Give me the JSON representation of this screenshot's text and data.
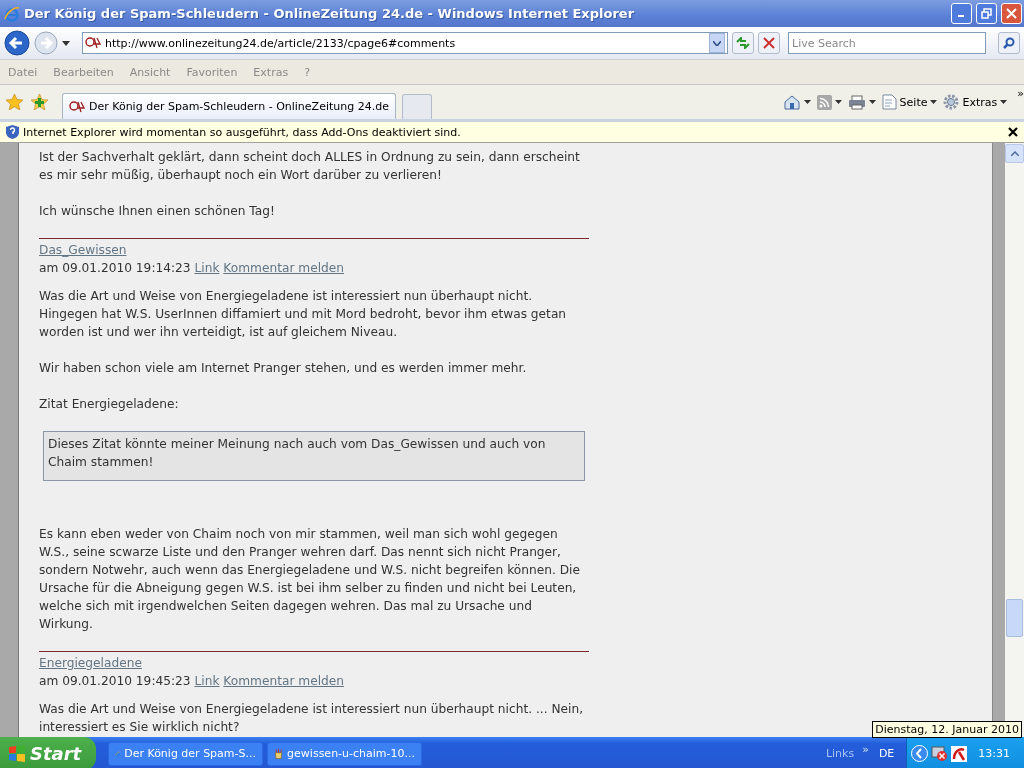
{
  "window": {
    "title": "Der König der Spam-Schleudern - OnlineZeitung 24.de - Windows Internet Explorer"
  },
  "address": {
    "value": "http://www.onlinezeitung24.de/article/2133/cpage6#comments"
  },
  "search": {
    "placeholder": "Live Search"
  },
  "menu": [
    "Datei",
    "Bearbeiten",
    "Ansicht",
    "Favoriten",
    "Extras",
    "?"
  ],
  "tabs": [
    {
      "label": "Der König der Spam-Schleudern - OnlineZeitung 24.de",
      "selected": true
    }
  ],
  "commands": [
    {
      "kind": "home"
    },
    {
      "kind": "feed"
    },
    {
      "kind": "print"
    },
    {
      "kind": "page",
      "label": "Seite"
    },
    {
      "kind": "tools",
      "label": "Extras"
    }
  ],
  "overflow": "»",
  "info_bar": {
    "text": "Internet Explorer wird momentan so ausgeführt, dass Add-Ons deaktiviert sind."
  },
  "intro": [
    "Ist der Sachverhalt geklärt, dann scheint doch ALLES in Ordnung zu sein, dann erscheint es mir sehr müßig, überhaupt noch ein Wort darüber zu verlieren!",
    "Ich wünsche Ihnen einen schönen Tag!"
  ],
  "comments": [
    {
      "author": "Das_Gewissen",
      "meta": "am 09.01.2010 19:14:23",
      "links": [
        "Link",
        "Kommentar melden"
      ],
      "blocks": [
        {
          "kind": "p",
          "text": "Was die Art und Weise von Energiegeladene ist interessiert nun überhaupt nicht. Hingegen hat W.S. UserInnen diffamiert und mit Mord bedroht, bevor ihm etwas getan worden ist und wer ihn verteidigt, ist auf gleichem Niveau."
        },
        {
          "kind": "p",
          "text": "Wir haben schon viele am Internet Pranger stehen, und es werden immer mehr."
        },
        {
          "kind": "p",
          "text": "Zitat Energiegeladene:"
        },
        {
          "kind": "quote",
          "text": "Dieses Zitat könnte meiner Meinung nach auch vom Das_Gewissen und auch von Chaim stammen!"
        },
        {
          "kind": "p",
          "text": "Es kann eben weder von Chaim noch von mir stammen, weil man sich wohl gegegen W.S., seine scwarze Liste und den Pranger wehren darf. Das nennt sich nicht Pranger, sondern Notwehr, auch wenn das Energiegeladene und W.S. nicht begreifen können. Die Ursache für die Abneigung gegen W.S. ist bei ihm selber zu finden und nicht bei Leuten, welche sich mit irgendwelchen Seiten dagegen wehren. Das mal zu Ursache und Wirkung."
        }
      ]
    },
    {
      "author": "Energiegeladene",
      "meta": "am 09.01.2010 19:45:23",
      "links": [
        "Link",
        "Kommentar melden"
      ],
      "blocks": [
        {
          "kind": "p",
          "text": "Was die Art und Weise von Energiegeladene ist interessiert nun überhaupt nicht. ... Nein, interessiert es Sie wirklich nicht?"
        }
      ]
    }
  ],
  "taskbar": {
    "start": "Start",
    "tasks": [
      {
        "label": "Der König der Spam-S...",
        "kind": "browser"
      },
      {
        "label": "gewissen-u-chaim-10...",
        "kind": "paint"
      }
    ],
    "links": "Links",
    "chevron": "»",
    "language": "DE",
    "clock": "13:31"
  },
  "tooltip": "Dienstag, 12. Januar 2010"
}
